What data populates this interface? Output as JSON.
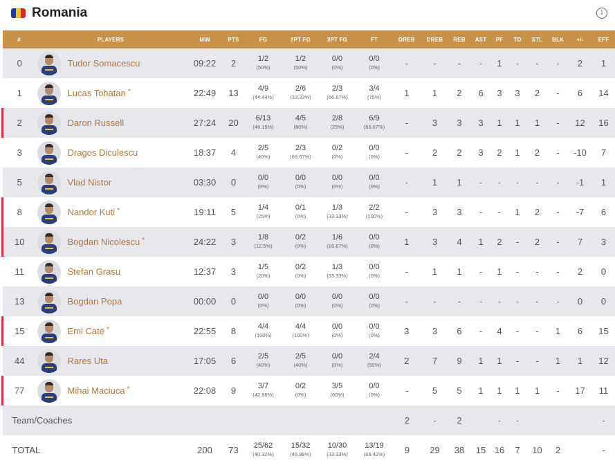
{
  "team": {
    "name": "Romania",
    "info_icon": "info-icon",
    "flag_colors": [
      "#1f3c8f",
      "#f2c318",
      "#d22a2a"
    ]
  },
  "columns": [
    "#",
    "PLAYERS",
    "MIN",
    "PTS",
    "FG",
    "2PT FG",
    "3PT FG",
    "FT",
    "OREB",
    "DREB",
    "REB",
    "AST",
    "PF",
    "TO",
    "STL",
    "BLK",
    "+/-",
    "EFF"
  ],
  "players": [
    {
      "no": "0",
      "name": "Tudor Somacescu",
      "star": "",
      "min": "09:22",
      "pts": "2",
      "fg": "1/2",
      "fg_pct": "(50%)",
      "fg2": "1/2",
      "fg2_pct": "(50%)",
      "fg3": "0/0",
      "fg3_pct": "(0%)",
      "ft": "0/0",
      "ft_pct": "(0%)",
      "oreb": "-",
      "dreb": "-",
      "reb": "-",
      "ast": "-",
      "pf": "1",
      "to": "-",
      "stl": "-",
      "blk": "-",
      "pm": "2",
      "eff": "1",
      "starter": false
    },
    {
      "no": "1",
      "name": "Lucas Tohatan",
      "star": "*",
      "min": "22:49",
      "pts": "13",
      "fg": "4/9",
      "fg_pct": "(44.44%)",
      "fg2": "2/6",
      "fg2_pct": "(33.33%)",
      "fg3": "2/3",
      "fg3_pct": "(66.67%)",
      "ft": "3/4",
      "ft_pct": "(75%)",
      "oreb": "1",
      "dreb": "1",
      "reb": "2",
      "ast": "6",
      "pf": "3",
      "to": "3",
      "stl": "2",
      "blk": "-",
      "pm": "6",
      "eff": "14",
      "starter": false
    },
    {
      "no": "2",
      "name": "Daron Russell",
      "star": "",
      "min": "27:24",
      "pts": "20",
      "fg": "6/13",
      "fg_pct": "(46.15%)",
      "fg2": "4/5",
      "fg2_pct": "(80%)",
      "fg3": "2/8",
      "fg3_pct": "(25%)",
      "ft": "6/9",
      "ft_pct": "(66.67%)",
      "oreb": "-",
      "dreb": "3",
      "reb": "3",
      "ast": "3",
      "pf": "1",
      "to": "1",
      "stl": "1",
      "blk": "-",
      "pm": "12",
      "eff": "16",
      "starter": true
    },
    {
      "no": "3",
      "name": "Dragos Diculescu",
      "star": "",
      "min": "18:37",
      "pts": "4",
      "fg": "2/5",
      "fg_pct": "(40%)",
      "fg2": "2/3",
      "fg2_pct": "(66.67%)",
      "fg3": "0/2",
      "fg3_pct": "(0%)",
      "ft": "0/0",
      "ft_pct": "(0%)",
      "oreb": "-",
      "dreb": "2",
      "reb": "2",
      "ast": "3",
      "pf": "2",
      "to": "1",
      "stl": "2",
      "blk": "-",
      "pm": "-10",
      "eff": "7",
      "starter": false
    },
    {
      "no": "5",
      "name": "Vlad Nistor",
      "star": "",
      "min": "03:30",
      "pts": "0",
      "fg": "0/0",
      "fg_pct": "(0%)",
      "fg2": "0/0",
      "fg2_pct": "(0%)",
      "fg3": "0/0",
      "fg3_pct": "(0%)",
      "ft": "0/0",
      "ft_pct": "(0%)",
      "oreb": "-",
      "dreb": "1",
      "reb": "1",
      "ast": "-",
      "pf": "-",
      "to": "-",
      "stl": "-",
      "blk": "-",
      "pm": "-1",
      "eff": "1",
      "starter": false
    },
    {
      "no": "8",
      "name": "Nandor Kuti",
      "star": "*",
      "min": "19:11",
      "pts": "5",
      "fg": "1/4",
      "fg_pct": "(25%)",
      "fg2": "0/1",
      "fg2_pct": "(0%)",
      "fg3": "1/3",
      "fg3_pct": "(33.33%)",
      "ft": "2/2",
      "ft_pct": "(100%)",
      "oreb": "-",
      "dreb": "3",
      "reb": "3",
      "ast": "-",
      "pf": "-",
      "to": "1",
      "stl": "2",
      "blk": "-",
      "pm": "-7",
      "eff": "6",
      "starter": true
    },
    {
      "no": "10",
      "name": "Bogdan Nicolescu",
      "star": "*",
      "min": "24:22",
      "pts": "3",
      "fg": "1/8",
      "fg_pct": "(12.5%)",
      "fg2": "0/2",
      "fg2_pct": "(0%)",
      "fg3": "1/6",
      "fg3_pct": "(16.67%)",
      "ft": "0/0",
      "ft_pct": "(0%)",
      "oreb": "1",
      "dreb": "3",
      "reb": "4",
      "ast": "1",
      "pf": "2",
      "to": "-",
      "stl": "2",
      "blk": "-",
      "pm": "7",
      "eff": "3",
      "starter": true
    },
    {
      "no": "11",
      "name": "Stefan Grasu",
      "star": "",
      "min": "12:37",
      "pts": "3",
      "fg": "1/5",
      "fg_pct": "(20%)",
      "fg2": "0/2",
      "fg2_pct": "(0%)",
      "fg3": "1/3",
      "fg3_pct": "(33.33%)",
      "ft": "0/0",
      "ft_pct": "(0%)",
      "oreb": "-",
      "dreb": "1",
      "reb": "1",
      "ast": "-",
      "pf": "1",
      "to": "-",
      "stl": "-",
      "blk": "-",
      "pm": "2",
      "eff": "0",
      "starter": false
    },
    {
      "no": "13",
      "name": "Bogdan Popa",
      "star": "",
      "min": "00:00",
      "pts": "0",
      "fg": "0/0",
      "fg_pct": "(0%)",
      "fg2": "0/0",
      "fg2_pct": "(0%)",
      "fg3": "0/0",
      "fg3_pct": "(0%)",
      "ft": "0/0",
      "ft_pct": "(0%)",
      "oreb": "-",
      "dreb": "-",
      "reb": "-",
      "ast": "-",
      "pf": "-",
      "to": "-",
      "stl": "-",
      "blk": "-",
      "pm": "0",
      "eff": "0",
      "starter": false
    },
    {
      "no": "15",
      "name": "Emi Cate",
      "star": "*",
      "min": "22:55",
      "pts": "8",
      "fg": "4/4",
      "fg_pct": "(100%)",
      "fg2": "4/4",
      "fg2_pct": "(100%)",
      "fg3": "0/0",
      "fg3_pct": "(0%)",
      "ft": "0/0",
      "ft_pct": "(0%)",
      "oreb": "3",
      "dreb": "3",
      "reb": "6",
      "ast": "-",
      "pf": "4",
      "to": "-",
      "stl": "-",
      "blk": "1",
      "pm": "6",
      "eff": "15",
      "starter": true
    },
    {
      "no": "44",
      "name": "Rares Uta",
      "star": "",
      "min": "17:05",
      "pts": "6",
      "fg": "2/5",
      "fg_pct": "(40%)",
      "fg2": "2/5",
      "fg2_pct": "(40%)",
      "fg3": "0/0",
      "fg3_pct": "(0%)",
      "ft": "2/4",
      "ft_pct": "(50%)",
      "oreb": "2",
      "dreb": "7",
      "reb": "9",
      "ast": "1",
      "pf": "1",
      "to": "-",
      "stl": "-",
      "blk": "1",
      "pm": "1",
      "eff": "12",
      "starter": false
    },
    {
      "no": "77",
      "name": "Mihai Maciuca",
      "star": "*",
      "min": "22:08",
      "pts": "9",
      "fg": "3/7",
      "fg_pct": "(42.86%)",
      "fg2": "0/2",
      "fg2_pct": "(0%)",
      "fg3": "3/5",
      "fg3_pct": "(60%)",
      "ft": "0/0",
      "ft_pct": "(0%)",
      "oreb": "-",
      "dreb": "5",
      "reb": "5",
      "ast": "1",
      "pf": "1",
      "to": "1",
      "stl": "1",
      "blk": "-",
      "pm": "17",
      "eff": "11",
      "starter": true
    }
  ],
  "coaches": {
    "label": "Team/Coaches",
    "oreb": "2",
    "dreb": "-",
    "reb": "2",
    "ast": "",
    "pf": "-",
    "to": "-",
    "stl": "",
    "blk": "",
    "pm": "",
    "eff": "-"
  },
  "total": {
    "label": "TOTAL",
    "min": "200",
    "pts": "73",
    "fg": "25/62",
    "fg_pct": "(40.32%)",
    "fg2": "15/32",
    "fg2_pct": "(46.88%)",
    "fg3": "10/30",
    "fg3_pct": "(33.33%)",
    "ft": "13/19",
    "ft_pct": "(68.42%)",
    "oreb": "9",
    "dreb": "29",
    "reb": "38",
    "ast": "15",
    "pf": "16",
    "to": "7",
    "stl": "10",
    "blk": "2",
    "pm": "",
    "eff": "-"
  }
}
